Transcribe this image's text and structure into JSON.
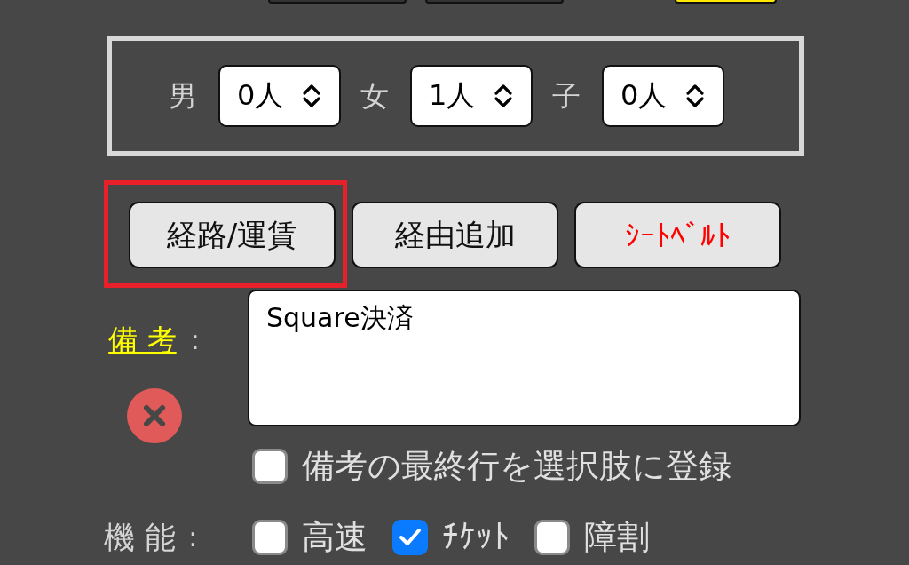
{
  "top_buttons": [
    {
      "color": "#333333"
    },
    {
      "color": "#333333"
    },
    {
      "color": "#ffe800"
    }
  ],
  "passengers": [
    {
      "label": "男",
      "value": "0人"
    },
    {
      "label": "女",
      "value": "1人"
    },
    {
      "label": "子",
      "value": "0人"
    }
  ],
  "actions": [
    {
      "label": "経路/運賃",
      "color": "#111111",
      "highlighted": true
    },
    {
      "label": "経由追加",
      "color": "#111111",
      "highlighted": false
    },
    {
      "label": "ｼｰﾄﾍﾞﾙﾄ",
      "color": "#ff0000",
      "highlighted": false
    }
  ],
  "remarks": {
    "label": "備 考",
    "colon": ":",
    "value": "Square決済"
  },
  "register_option": {
    "label": "備考の最終行を選択肢に登録",
    "checked": false
  },
  "features": {
    "label": "機 能",
    "colon": ":",
    "options": [
      {
        "label": "高速",
        "checked": false
      },
      {
        "label": "ﾁｹｯﾄ",
        "checked": true
      },
      {
        "label": "障割",
        "checked": false
      }
    ]
  }
}
